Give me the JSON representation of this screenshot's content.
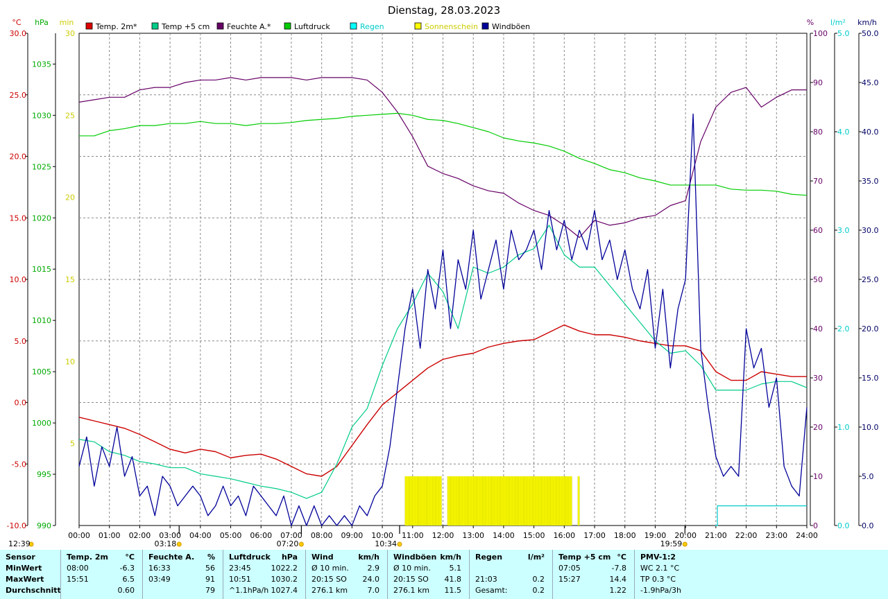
{
  "chart_data": {
    "type": "line",
    "title": "Dienstag, 28.03.2023",
    "x_ticks": [
      "00:00",
      "01:00",
      "02:00",
      "03:00",
      "04:00",
      "05:00",
      "06:00",
      "07:00",
      "08:00",
      "09:00",
      "10:00",
      "11:00",
      "12:00",
      "13:00",
      "14:00",
      "15:00",
      "16:00",
      "17:00",
      "18:00",
      "19:00",
      "20:00",
      "21:00",
      "22:00",
      "23:00",
      "24:00"
    ],
    "axes": {
      "temp": {
        "unit": "°C",
        "range": [
          -10,
          30
        ],
        "ticks": [
          "30.0",
          "25.0",
          "20.0",
          "15.0",
          "10.0",
          "5.0",
          "0.0",
          "-5.0",
          "-10.0"
        ],
        "color": "#cc0000"
      },
      "pressure": {
        "unit": "hPa",
        "range": [
          990,
          1038
        ],
        "ticks": [
          "1035",
          "1030",
          "1025",
          "1020",
          "1015",
          "1010",
          "1005",
          "1000",
          "995",
          "990"
        ],
        "color": "#00aa00"
      },
      "sunshine": {
        "unit": "min",
        "range": [
          0,
          30
        ],
        "ticks": [
          "30",
          "25",
          "20",
          "15",
          "10",
          "5"
        ],
        "color": "#cccc00"
      },
      "humidity": {
        "unit": "%",
        "range": [
          0,
          100
        ],
        "ticks": [
          "100",
          "90",
          "80",
          "70",
          "60",
          "50",
          "40",
          "30",
          "20",
          "10",
          "0"
        ],
        "color": "#660066"
      },
      "rain": {
        "unit": "l/m²",
        "range": [
          0,
          5
        ],
        "ticks": [
          "5.0",
          "4.0",
          "3.0",
          "2.0",
          "1.0",
          "0.0"
        ],
        "color": "#00cccc"
      },
      "wind": {
        "unit": "km/h",
        "range": [
          0,
          50
        ],
        "ticks": [
          "50.0",
          "45.0",
          "40.0",
          "35.0",
          "30.0",
          "25.0",
          "20.0",
          "15.0",
          "10.0",
          "5.0",
          "0.0"
        ],
        "color": "#000066"
      }
    },
    "legend": [
      {
        "label": "Temp. 2m*",
        "color": "#dd0000"
      },
      {
        "label": "Temp +5 cm",
        "color": "#00cc88"
      },
      {
        "label": "Feuchte A.*",
        "color": "#660066"
      },
      {
        "label": "Luftdruck",
        "color": "#00cc00"
      },
      {
        "label": "Regen",
        "color": "#00ffff"
      },
      {
        "label": "Sonnenschein",
        "color": "#ffff00"
      },
      {
        "label": "Windböen",
        "color": "#000099"
      }
    ],
    "series": [
      {
        "name": "Temp. 2m*",
        "axis": "temp",
        "color": "#cc0000",
        "x": [
          0,
          0.5,
          1,
          1.5,
          2,
          2.5,
          3,
          3.5,
          4,
          4.5,
          5,
          5.5,
          6,
          6.5,
          7,
          7.5,
          8,
          8.5,
          9,
          9.5,
          10,
          10.5,
          11,
          11.5,
          12,
          12.5,
          13,
          13.5,
          14,
          14.5,
          15,
          15.5,
          16,
          16.5,
          17,
          17.5,
          18,
          18.5,
          19,
          19.5,
          20,
          20.5,
          21,
          21.5,
          22,
          22.5,
          23,
          23.5,
          24
        ],
        "y": [
          -1.2,
          -1.5,
          -1.8,
          -2.1,
          -2.6,
          -3.2,
          -3.8,
          -4.1,
          -3.8,
          -4.0,
          -4.5,
          -4.3,
          -4.2,
          -4.6,
          -5.2,
          -5.8,
          -6.0,
          -5.2,
          -3.5,
          -1.8,
          -0.2,
          0.8,
          1.8,
          2.8,
          3.5,
          3.8,
          4.0,
          4.5,
          4.8,
          5.0,
          5.1,
          5.7,
          6.3,
          5.8,
          5.5,
          5.5,
          5.3,
          5.0,
          4.8,
          4.6,
          4.6,
          4.2,
          2.5,
          1.8,
          1.8,
          2.5,
          2.3,
          2.1,
          2.1
        ]
      },
      {
        "name": "Temp +5 cm",
        "axis": "temp",
        "color": "#00cc88",
        "x": [
          0,
          0.5,
          1,
          1.5,
          2,
          2.5,
          3,
          3.5,
          4,
          4.5,
          5,
          5.5,
          6,
          6.5,
          7,
          7.5,
          8,
          8.5,
          9,
          9.5,
          10,
          10.5,
          11,
          11.5,
          12,
          12.5,
          13,
          13.5,
          14,
          14.5,
          15,
          15.5,
          16,
          16.5,
          17,
          17.5,
          18,
          18.5,
          19,
          19.5,
          20,
          20.5,
          21,
          21.5,
          22,
          22.5,
          23,
          23.5,
          24
        ],
        "y": [
          -3.0,
          -3.2,
          -4.0,
          -4.3,
          -4.8,
          -5.0,
          -5.3,
          -5.3,
          -5.8,
          -6.0,
          -6.2,
          -6.5,
          -6.8,
          -7.0,
          -7.3,
          -7.8,
          -7.3,
          -5.0,
          -2.0,
          -0.5,
          3.0,
          6.0,
          8.0,
          10.5,
          9.0,
          6.0,
          11.0,
          10.5,
          11.0,
          12.0,
          12.5,
          14.4,
          12.0,
          11.0,
          11.0,
          9.5,
          8.0,
          6.5,
          5.0,
          4.0,
          4.2,
          3.0,
          1.0,
          1.0,
          1.0,
          1.5,
          1.7,
          1.7,
          1.2
        ]
      },
      {
        "name": "Feuchte A.*",
        "axis": "humidity",
        "color": "#660066",
        "x": [
          0,
          0.5,
          1,
          1.5,
          2,
          2.5,
          3,
          3.5,
          4,
          4.5,
          5,
          5.5,
          6,
          6.5,
          7,
          7.5,
          8,
          8.5,
          9,
          9.5,
          10,
          10.5,
          11,
          11.5,
          12,
          12.5,
          13,
          13.5,
          14,
          14.5,
          15,
          15.5,
          16,
          16.5,
          17,
          17.5,
          18,
          18.5,
          19,
          19.5,
          20,
          20.5,
          21,
          21.5,
          22,
          22.5,
          23,
          23.5,
          24
        ],
        "y": [
          86,
          86.5,
          87,
          87,
          88.5,
          89,
          89,
          90,
          90.5,
          90.5,
          91,
          90.5,
          91,
          91,
          91,
          90.5,
          91,
          91,
          91,
          90.5,
          88,
          84,
          79,
          73,
          71.5,
          70.5,
          69,
          68,
          67.5,
          65.5,
          64,
          63,
          61,
          58.5,
          62,
          61,
          61.5,
          62.5,
          63,
          65,
          66,
          78,
          85,
          88,
          89,
          85,
          87,
          88.5,
          88.5
        ]
      },
      {
        "name": "Luftdruck",
        "axis": "pressure",
        "color": "#00cc00",
        "x": [
          0,
          0.5,
          1,
          1.5,
          2,
          2.5,
          3,
          3.5,
          4,
          4.5,
          5,
          5.5,
          6,
          6.5,
          7,
          7.5,
          8,
          8.5,
          9,
          9.5,
          10,
          10.5,
          11,
          11.5,
          12,
          12.5,
          13,
          13.5,
          14,
          14.5,
          15,
          15.5,
          16,
          16.5,
          17,
          17.5,
          18,
          18.5,
          19,
          19.5,
          20,
          20.5,
          21,
          21.5,
          22,
          22.5,
          23,
          23.5,
          24
        ],
        "y": [
          1028.0,
          1028.0,
          1028.5,
          1028.7,
          1029.0,
          1029.0,
          1029.2,
          1029.2,
          1029.4,
          1029.2,
          1029.2,
          1029.0,
          1029.2,
          1029.2,
          1029.3,
          1029.5,
          1029.6,
          1029.7,
          1029.9,
          1030.0,
          1030.1,
          1030.2,
          1030.0,
          1029.6,
          1029.5,
          1029.2,
          1028.8,
          1028.4,
          1027.8,
          1027.5,
          1027.3,
          1027.0,
          1026.5,
          1025.8,
          1025.3,
          1024.7,
          1024.4,
          1023.9,
          1023.6,
          1023.2,
          1023.2,
          1023.2,
          1023.2,
          1022.8,
          1022.7,
          1022.7,
          1022.6,
          1022.3,
          1022.2
        ]
      },
      {
        "name": "Regen",
        "axis": "rain",
        "color": "#00cccc",
        "step": true,
        "x": [
          20.98,
          21.05,
          24
        ],
        "y": [
          0,
          0.2,
          0.2
        ]
      },
      {
        "name": "Windböen",
        "axis": "wind",
        "color": "#000099",
        "x": [
          0,
          0.25,
          0.5,
          0.75,
          1,
          1.25,
          1.5,
          1.75,
          2,
          2.25,
          2.5,
          2.75,
          3,
          3.25,
          3.5,
          3.75,
          4,
          4.25,
          4.5,
          4.75,
          5,
          5.25,
          5.5,
          5.75,
          6,
          6.25,
          6.5,
          6.75,
          7,
          7.25,
          7.5,
          7.75,
          8,
          8.25,
          8.5,
          8.75,
          9,
          9.25,
          9.5,
          9.75,
          10,
          10.25,
          10.5,
          10.75,
          11,
          11.25,
          11.5,
          11.75,
          12,
          12.25,
          12.5,
          12.75,
          13,
          13.25,
          13.5,
          13.75,
          14,
          14.25,
          14.5,
          14.75,
          15,
          15.25,
          15.5,
          15.75,
          16,
          16.25,
          16.5,
          16.75,
          17,
          17.25,
          17.5,
          17.75,
          18,
          18.25,
          18.5,
          18.75,
          19,
          19.25,
          19.5,
          19.75,
          20,
          20.25,
          20.5,
          20.75,
          21,
          21.25,
          21.5,
          21.75,
          22,
          22.25,
          22.5,
          22.75,
          23,
          23.25,
          23.5,
          23.75,
          24
        ],
        "y": [
          6,
          9,
          4,
          8,
          6,
          10,
          5,
          7,
          3,
          4,
          1,
          5,
          4,
          2,
          3,
          4,
          3,
          1,
          2,
          4,
          2,
          3,
          1,
          4,
          3,
          2,
          1,
          3,
          0,
          2,
          0,
          2,
          0,
          1,
          0,
          1,
          0,
          2,
          1,
          3,
          4,
          8,
          14,
          20,
          24,
          18,
          26,
          22,
          28,
          20,
          27,
          24,
          30,
          23,
          26,
          29,
          24,
          30,
          27,
          28,
          30,
          26,
          32,
          28,
          31,
          27,
          30,
          28,
          32,
          27,
          29,
          25,
          28,
          24,
          22,
          26,
          18,
          24,
          16,
          22,
          25,
          41.8,
          18,
          12,
          7,
          5,
          6,
          5,
          20,
          16,
          18,
          12,
          15,
          6,
          4,
          3,
          12
        ]
      }
    ],
    "sunshine_bars": {
      "axis": "sunshine",
      "color": "#ffff00",
      "stroke": "#c8c800",
      "ranges": [
        [
          10.75,
          11.95
        ],
        [
          12.15,
          16.25
        ],
        [
          16.45,
          16.5
        ]
      ],
      "height": 3
    },
    "markers": [
      {
        "x": 3.3,
        "label": "03:18"
      },
      {
        "x": 7.33,
        "label": "07:20"
      },
      {
        "x": 10.57,
        "label": "10:34"
      },
      {
        "x": 19.98,
        "label": "19:59"
      }
    ],
    "corner_time": "12:39"
  },
  "stats": {
    "columns": [
      {
        "head": "Sensor",
        "rows": [
          "MinWert",
          "MaxWert",
          "Durchschnitt"
        ]
      },
      {
        "head": "Temp. 2m",
        "unit": "°C",
        "rows": [
          [
            "08:00",
            "-6.3"
          ],
          [
            "15:51",
            "6.5"
          ],
          [
            "",
            "0.60"
          ]
        ]
      },
      {
        "head": "Feuchte A.",
        "unit": "%",
        "rows": [
          [
            "16:33",
            "56"
          ],
          [
            "03:49",
            "91"
          ],
          [
            "",
            "79"
          ]
        ]
      },
      {
        "head": "Luftdruck",
        "unit": "hPa",
        "rows": [
          [
            "23:45",
            "1022.2"
          ],
          [
            "10:51",
            "1030.2"
          ],
          [
            "^1.1hPa/h",
            "1027.4"
          ]
        ]
      },
      {
        "head": "Wind",
        "unit": "km/h",
        "rows": [
          [
            "Ø 10 min.",
            "2.9"
          ],
          [
            "20:15     SO",
            "24.0"
          ],
          [
            "276.1 km",
            "7.0"
          ]
        ]
      },
      {
        "head": "Windböen",
        "unit": "km/h",
        "rows": [
          [
            "Ø 10 min.",
            "5.1"
          ],
          [
            "20:15     SO",
            "41.8"
          ],
          [
            "276.1 km",
            "11.5"
          ]
        ]
      },
      {
        "head": "Regen",
        "unit": "l/m²",
        "rows": [
          [
            "",
            ""
          ],
          [
            "21:03",
            "0.2"
          ],
          [
            "Gesamt:",
            "0.2"
          ]
        ]
      },
      {
        "head": "Temp +5 cm",
        "unit": "°C",
        "rows": [
          [
            "07:05",
            "-7.8"
          ],
          [
            "15:27",
            "14.4"
          ],
          [
            "",
            "1.22"
          ]
        ]
      },
      {
        "head": "PMV-1:2",
        "rows": [
          "WC 2.1 °C",
          "TP 0.3 °C",
          "-1.9hPa/3h"
        ]
      }
    ]
  }
}
